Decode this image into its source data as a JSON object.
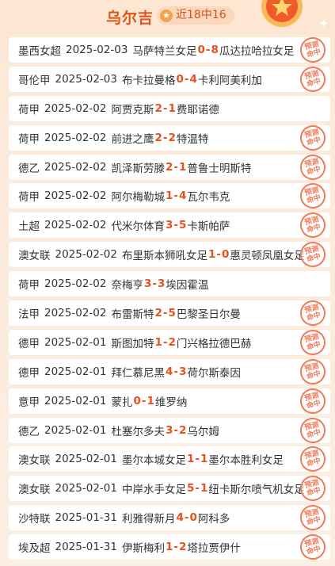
{
  "header": {
    "title": "乌尔吉",
    "badge_label": "近18中16"
  },
  "stamp": {
    "line1": "预测",
    "line2": "命中"
  },
  "matches": [
    {
      "league": "墨西女超",
      "date": "2025-02-03",
      "home": "马萨特兰女足",
      "hs": "0",
      "as": "8",
      "away": "瓜达拉哈拉女足",
      "hit": true
    },
    {
      "league": "哥伦甲",
      "date": "2025-02-03",
      "home": "布卡拉曼格",
      "hs": "0",
      "as": "4",
      "away": "卡利阿美利加",
      "hit": true
    },
    {
      "league": "荷甲",
      "date": "2025-02-02",
      "home": "阿贾克斯",
      "hs": "2",
      "as": "1",
      "away": "费耶诺德",
      "hit": false
    },
    {
      "league": "荷甲",
      "date": "2025-02-02",
      "home": "前进之鹰",
      "hs": "2",
      "as": "2",
      "away": "特温特",
      "hit": true
    },
    {
      "league": "德乙",
      "date": "2025-02-02",
      "home": "凯泽斯劳滕",
      "hs": "2",
      "as": "1",
      "away": "普鲁士明斯特",
      "hit": true
    },
    {
      "league": "荷甲",
      "date": "2025-02-02",
      "home": "阿尔梅勒城",
      "hs": "1",
      "as": "4",
      "away": "瓦尔韦克",
      "hit": true
    },
    {
      "league": "土超",
      "date": "2025-02-02",
      "home": "代米尔体育",
      "hs": "3",
      "as": "5",
      "away": "卡斯帕萨",
      "hit": true
    },
    {
      "league": "澳女联",
      "date": "2025-02-02",
      "home": "布里斯本狮吼女足",
      "hs": "1",
      "as": "0",
      "away": "惠灵顿凤凰女足",
      "hit": true
    },
    {
      "league": "荷甲",
      "date": "2025-02-02",
      "home": "奈梅亨",
      "hs": "3",
      "as": "3",
      "away": "埃因霍温",
      "hit": false
    },
    {
      "league": "法甲",
      "date": "2025-02-02",
      "home": "布雷斯特",
      "hs": "2",
      "as": "5",
      "away": "巴黎圣日尔曼",
      "hit": true
    },
    {
      "league": "德甲",
      "date": "2025-02-01",
      "home": "斯图加特",
      "hs": "1",
      "as": "2",
      "away": "门兴格拉德巴赫",
      "hit": true
    },
    {
      "league": "德甲",
      "date": "2025-02-01",
      "home": "拜仁慕尼黑",
      "hs": "4",
      "as": "3",
      "away": "荷尔斯泰因",
      "hit": true
    },
    {
      "league": "意甲",
      "date": "2025-02-01",
      "home": "蒙扎",
      "hs": "0",
      "as": "1",
      "away": "维罗纳",
      "hit": true
    },
    {
      "league": "德乙",
      "date": "2025-02-01",
      "home": "杜塞尔多夫",
      "hs": "3",
      "as": "2",
      "away": "乌尔姆",
      "hit": true
    },
    {
      "league": "澳女联",
      "date": "2025-02-01",
      "home": "墨尔本城女足",
      "hs": "1",
      "as": "1",
      "away": "墨尔本胜利女足",
      "hit": true
    },
    {
      "league": "澳女联",
      "date": "2025-02-01",
      "home": "中岸水手女足",
      "hs": "5",
      "as": "1",
      "away": "纽卡斯尔喷气机女足",
      "hit": true
    },
    {
      "league": "沙特联",
      "date": "2025-01-31",
      "home": "利雅得新月",
      "hs": "4",
      "as": "0",
      "away": "阿科多",
      "hit": true
    },
    {
      "league": "埃及超",
      "date": "2025-01-31",
      "home": "伊斯梅利",
      "hs": "1",
      "as": "2",
      "away": "塔拉贾伊什",
      "hit": true
    }
  ]
}
